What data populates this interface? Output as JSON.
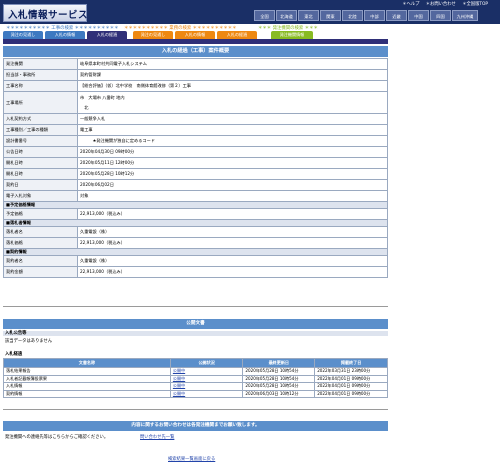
{
  "header": {
    "logo": "入札情報サービス",
    "links": [
      "＊ヘルプ",
      "＊お問い合わせ",
      "＊全国版TOP"
    ],
    "regions": [
      "全国",
      "北海道",
      "東北",
      "関東",
      "北陸",
      "中部",
      "近畿",
      "中国",
      "四国",
      "九州沖縄"
    ]
  },
  "search_modes": [
    "＊＊＊＊＊＊＊＊＊＊ 工事の検索 ＊＊＊＊＊＊＊＊＊＊",
    "＊＊＊＊＊＊＊＊＊＊ 業務の検索 ＊＊＊＊＊＊＊＊＊＊",
    "＊＊＊ 発注機関の検索 ＊＊＊"
  ],
  "tabs": [
    "発注の見通し",
    "入札の情報",
    "入札の経過",
    "発注の見通し",
    "入札の情報",
    "入札の経過",
    "発注機関情報"
  ],
  "page": {
    "title": "入札の経過（工事）案件概要"
  },
  "details": [
    {
      "k": "発注機関",
      "v": "岐阜県本町村共同電子入札システム"
    },
    {
      "k": "担当部・事務所",
      "v": "契約管財課"
    },
    {
      "k": "工事名称",
      "v": "【総合評価】（仮）北中学校　南側体育館改修（第２）工事"
    },
    {
      "k": "工事場所",
      "v": "市　大場市 八番町 地内",
      "v2": "　北"
    },
    {
      "k": "入札契約方式",
      "v": "一般競争入札"
    },
    {
      "k": "工事種別／工事の種類",
      "v": "電工事"
    },
    {
      "k": "設計書番号",
      "v": "　　　★発注機関が独自に定めるコード"
    },
    {
      "k": "公告日時",
      "v": "2020年04月30日 09時00分"
    },
    {
      "k": "開札日時",
      "v": "2020年05月11日 12時00分"
    },
    {
      "k": "開札日時",
      "v": "2020年05月28日 10時12分"
    },
    {
      "k": "契約日",
      "v": "2020年06月02日"
    },
    {
      "k": "電子入札対象",
      "v": "対象"
    }
  ],
  "sections": {
    "yotei": {
      "title": "■予定価格情報",
      "k": "予定価格",
      "v": "22,913,000（税込み）"
    },
    "rakusatsu": {
      "title": "■落札者情報",
      "rows": [
        {
          "k": "落札者名",
          "v": "久重電設（株）"
        },
        {
          "k": "落札価格",
          "v": "22,913,000（税込み）"
        }
      ]
    },
    "keiyaku": {
      "title": "■契約情報",
      "rows": [
        {
          "k": "契約者名",
          "v": "久重電設（株）"
        },
        {
          "k": "契約金額",
          "v": "22,913,000（税込み）"
        }
      ]
    }
  },
  "public_docs": {
    "title": "公開文書",
    "notice_head": "入札公告等",
    "notice_text": "該当データはありません",
    "keika_head": "入札経過",
    "columns": [
      "文書名称",
      "公開状況",
      "最終更新日",
      "掲載終了日"
    ],
    "rows": [
      {
        "name": "落札結果報告",
        "status": "公開中",
        "updated": "2020年05月28日 10時54分",
        "end": "2022年03月31日 23時00分"
      },
      {
        "name": "入札者記載帳簿投票果",
        "status": "公開中",
        "updated": "2020年05月28日 10時54分",
        "end": "2022年04月01日 09時00分"
      },
      {
        "name": "入札情報",
        "status": "公開中",
        "updated": "2020年05月28日 10時54分",
        "end": "2022年04月01日 09時00分"
      },
      {
        "name": "契約情報",
        "status": "公開中",
        "updated": "2020年06月03日 10時12分",
        "end": "2022年04月01日 09時00分"
      }
    ]
  },
  "contact": {
    "title": "内容に関するお問い合わせは各発注機関までお願い致します。",
    "text": "発注機関への連絡先等はこちらからご確認ください。",
    "link": "問い合わせ先一覧"
  },
  "footer": {
    "back": "検索結果一覧画面に戻る"
  },
  "colors": {
    "navy": "#1a2f66",
    "header_blue": "#5b8fcb",
    "construction_tab": "#3d79c1",
    "service_tab": "#ee8811",
    "agency_tab": "#88bb22"
  }
}
